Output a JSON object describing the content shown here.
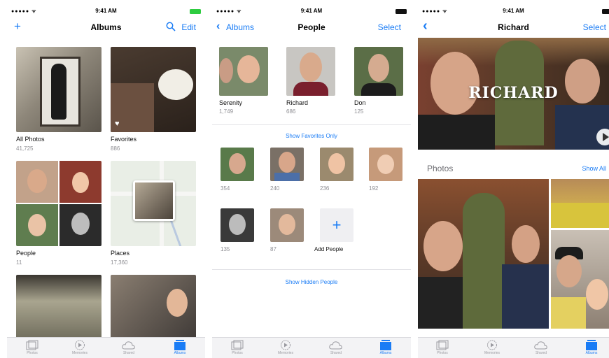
{
  "status": {
    "signal": "●●●●● ᯤ",
    "time": "9:41 AM"
  },
  "albums": {
    "nav": {
      "add_symbol": "+",
      "title": "Albums",
      "edit": "Edit"
    },
    "items": [
      {
        "name": "All Photos",
        "count": "41,725"
      },
      {
        "name": "Favorites",
        "count": "886"
      },
      {
        "name": "People",
        "count": "11"
      },
      {
        "name": "Places",
        "count": "17,360"
      }
    ]
  },
  "people": {
    "nav": {
      "back": "Albums",
      "title": "People",
      "select": "Select"
    },
    "favorites": [
      {
        "name": "Serenity",
        "count": "1,749"
      },
      {
        "name": "Richard",
        "count": "686"
      },
      {
        "name": "Don",
        "count": "125"
      }
    ],
    "show_favorites_only": "Show Favorites Only",
    "others": [
      {
        "count": "354"
      },
      {
        "count": "240"
      },
      {
        "count": "236"
      },
      {
        "count": "192"
      },
      {
        "count": "135"
      },
      {
        "count": "87"
      }
    ],
    "add_people_symbol": "+",
    "add_people": "Add People",
    "show_hidden": "Show Hidden People"
  },
  "richard": {
    "nav": {
      "title": "Richard",
      "select": "Select"
    },
    "hero_title": "RICHARD",
    "photos_heading": "Photos",
    "show_all": "Show All"
  },
  "tabbar": {
    "labels": [
      "Photos",
      "Memories",
      "Shared",
      "Albums"
    ],
    "active": "Albums"
  },
  "colors": {
    "accent": "#1a7cf5",
    "secondary_text": "#8e8e93"
  }
}
